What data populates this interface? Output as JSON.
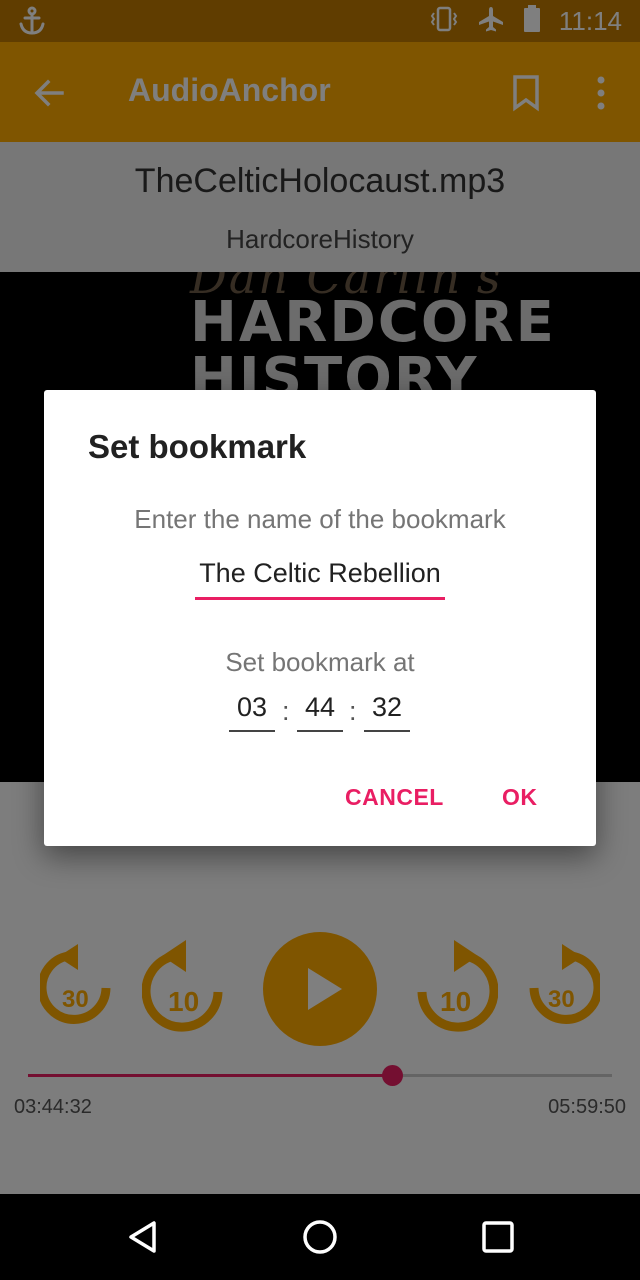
{
  "status_bar": {
    "time": "11:14"
  },
  "app_bar": {
    "title": "AudioAnchor"
  },
  "track": {
    "file_name": "TheCelticHolocaust.mp3",
    "folder": "HardcoreHistory"
  },
  "cover_art": {
    "line1": "Dan Carlin's",
    "line2": "HARDCORE",
    "line3": "HISTORY"
  },
  "player": {
    "rewind_30_label": "30",
    "rewind_10_label": "10",
    "forward_10_label": "10",
    "forward_30_label": "30",
    "current_time": "03:44:32",
    "total_time": "05:59:50",
    "progress_fraction": 0.624
  },
  "dialog": {
    "title": "Set bookmark",
    "prompt": "Enter the name of the bookmark",
    "name_value": "The Celtic Rebellion",
    "at_label": "Set bookmark at",
    "hours": "03",
    "minutes": "44",
    "seconds": "32",
    "separator": ":",
    "cancel_label": "CANCEL",
    "ok_label": "OK"
  },
  "colors": {
    "primary": "#ffaa00",
    "primary_dark": "#c17a00",
    "accent": "#e91e63"
  }
}
